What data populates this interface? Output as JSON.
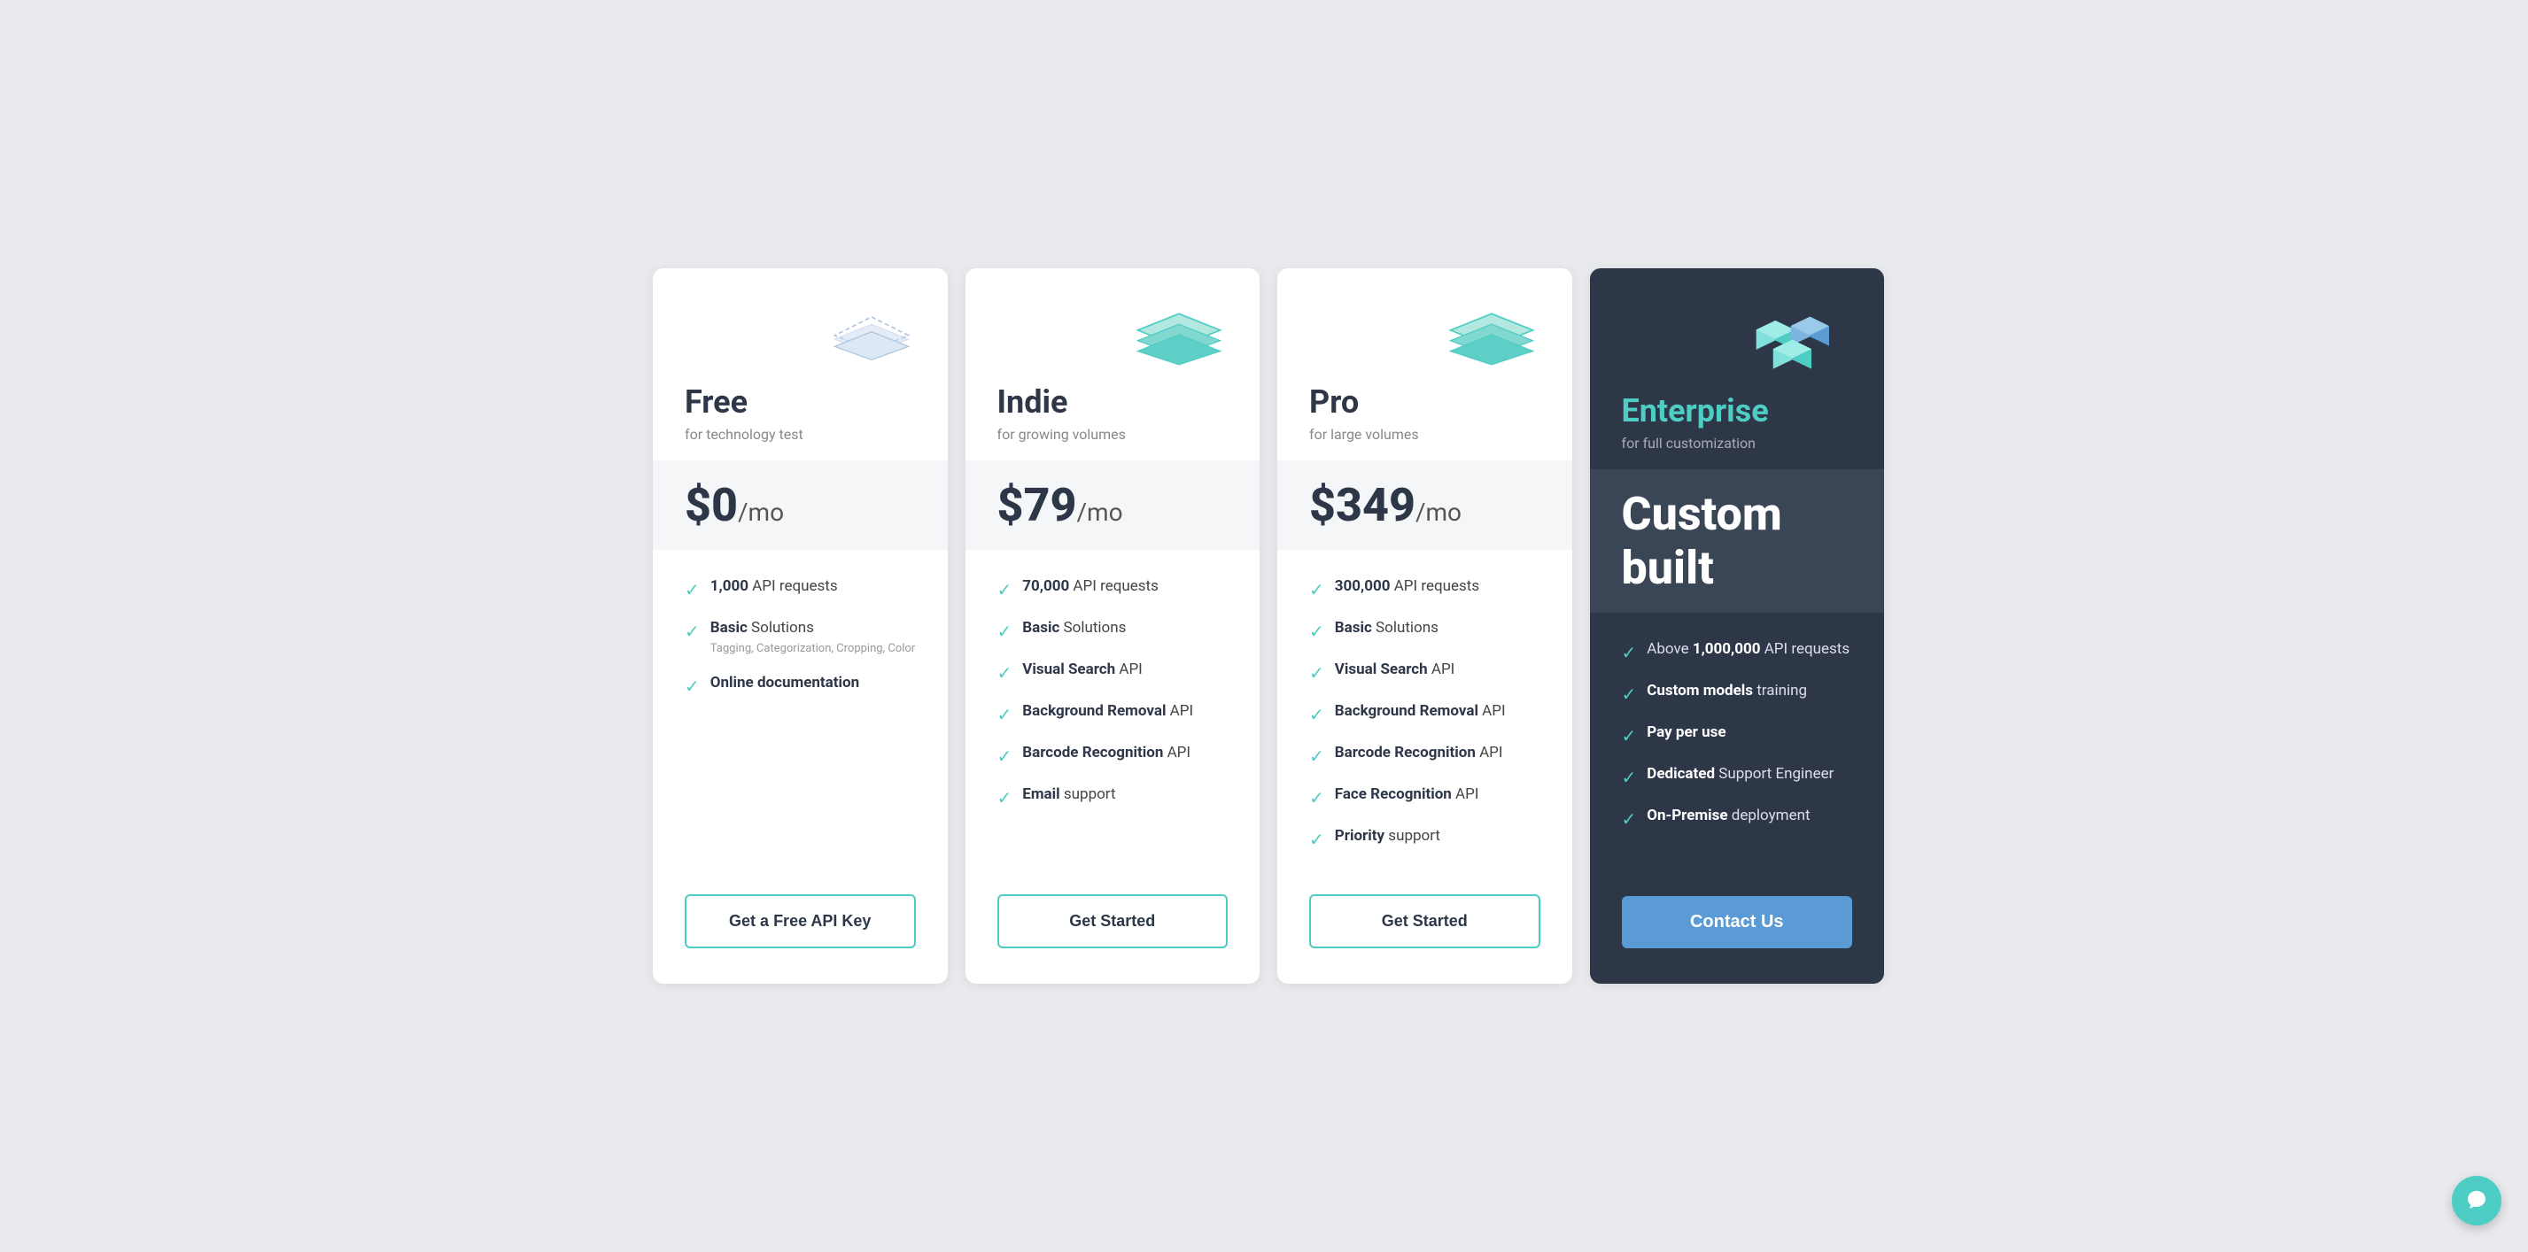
{
  "plans": [
    {
      "id": "free",
      "name": "Free",
      "subtitle": "for technology test",
      "price": "$0",
      "period": "/mo",
      "features": [
        {
          "bold": "1,000",
          "text": " API requests",
          "sub": ""
        },
        {
          "bold": "Basic",
          "text": " Solutions",
          "sub": "Tagging, Categorization, Cropping, Color"
        },
        {
          "bold": "Online documentation",
          "text": "",
          "sub": ""
        }
      ],
      "cta": "Get a Free API Key"
    },
    {
      "id": "indie",
      "name": "Indie",
      "subtitle": "for growing volumes",
      "price": "$79",
      "period": "/mo",
      "features": [
        {
          "bold": "70,000",
          "text": " API requests",
          "sub": ""
        },
        {
          "bold": "Basic",
          "text": " Solutions",
          "sub": ""
        },
        {
          "bold": "Visual Search",
          "text": " API",
          "sub": ""
        },
        {
          "bold": "Background Removal",
          "text": " API",
          "sub": ""
        },
        {
          "bold": "Barcode Recognition",
          "text": " API",
          "sub": ""
        },
        {
          "bold": "Email",
          "text": " support",
          "sub": ""
        }
      ],
      "cta": "Get Started"
    },
    {
      "id": "pro",
      "name": "Pro",
      "subtitle": "for large volumes",
      "price": "$349",
      "period": "/mo",
      "features": [
        {
          "bold": "300,000",
          "text": " API requests",
          "sub": ""
        },
        {
          "bold": "Basic",
          "text": " Solutions",
          "sub": ""
        },
        {
          "bold": "Visual Search",
          "text": " API",
          "sub": ""
        },
        {
          "bold": "Background Removal",
          "text": " API",
          "sub": ""
        },
        {
          "bold": "Barcode Recognition",
          "text": " API",
          "sub": ""
        },
        {
          "bold": "Face Recognition",
          "text": " API",
          "sub": ""
        },
        {
          "bold": "Priority",
          "text": " support",
          "sub": ""
        }
      ],
      "cta": "Get Started"
    },
    {
      "id": "enterprise",
      "name": "Enterprise",
      "subtitle": "for full customization",
      "price": "Custom built",
      "period": "",
      "features": [
        {
          "bold": "Above 1,000,000",
          "text": " API requests",
          "sub": ""
        },
        {
          "bold": "Custom models",
          "text": " training",
          "sub": ""
        },
        {
          "bold": "Pay per use",
          "text": "",
          "sub": ""
        },
        {
          "bold": "Dedicated",
          "text": " Support Engineer",
          "sub": ""
        },
        {
          "bold": "On-Premise",
          "text": " deployment",
          "sub": ""
        }
      ],
      "cta": "Contact Us"
    }
  ],
  "colors": {
    "teal": "#4ecdc4",
    "dark": "#2d3748",
    "enterprise_bg": "#2d3748",
    "enterprise_price_bg": "#3a4556",
    "blue_btn": "#5b9bd5"
  }
}
